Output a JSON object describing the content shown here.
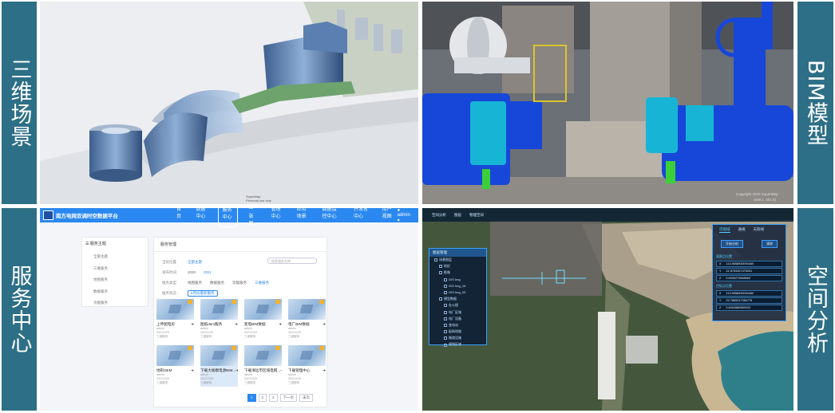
{
  "labels": {
    "q1": "三维场景",
    "q2": "BIM模型",
    "q3": "服务中心",
    "q4": "空间分析"
  },
  "scene3d": {
    "watermark_line1": "SuperMap",
    "watermark_line2": "Personal use only"
  },
  "bim": {
    "watermark": "Copyright 2020 SuperMap",
    "coords": "(509,1, 301.5)"
  },
  "service": {
    "header": {
      "title": "南方电网双调时空数据平台",
      "nav": [
        "首页",
        "数据中心",
        "服务中心",
        "一张图",
        "管理中心",
        "应用场景",
        "数据监控中心",
        "开发者中心",
        "用户视图"
      ],
      "active_index": 2,
      "user": "admin"
    },
    "left_panel": {
      "title": "服务主题",
      "items": [
        "全部主题",
        "三维服务",
        "地图服务",
        "数据服务",
        "功能服务"
      ]
    },
    "main_panel": {
      "title": "服务管理",
      "search_placeholder": "搜索服务名称",
      "filters": [
        {
          "label": "当前位置",
          "values": [
            "全部主题"
          ]
        },
        {
          "label": "发布时间",
          "values": [
            "2020",
            "2021"
          ]
        },
        {
          "label": "服务类型",
          "values": [
            "地图服务",
            "数据服务",
            "功能服务",
            "三维服务"
          ]
        },
        {
          "label": "服务状态",
          "values": [
            "5月份最新服务"
          ]
        }
      ]
    },
    "cards": [
      {
        "name": "上传配电房",
        "user": "admin",
        "date": "2021/1/29",
        "views": "三维服务"
      },
      {
        "name": "图纸dem服务",
        "user": "admin",
        "date": "2021/1/29",
        "views": "三维服务"
      },
      {
        "name": "变电BIM数据",
        "user": "admin",
        "date": "2021/1/29",
        "views": "三维服务"
      },
      {
        "name": "电厂BIM数据",
        "user": "admin",
        "date": "2021/1/29",
        "views": "三维服务"
      },
      {
        "name": "地形DEM",
        "user": "admin",
        "date": "2021/1/29",
        "views": "三维服务"
      },
      {
        "name": "下载大规模电源BIM...",
        "user": "admin",
        "date": "2021/1/29",
        "views": "三维服务"
      },
      {
        "name": "下载清远市区域电网...",
        "user": "admin",
        "date": "2021/1/29",
        "views": "三维服务"
      },
      {
        "name": "下载管理中心",
        "user": "admin",
        "date": "2021/1/29",
        "views": "三维服务"
      }
    ],
    "pager": [
      "1",
      "2",
      "3",
      "下一页",
      "末页"
    ]
  },
  "spatial": {
    "topbar": [
      "空间分析",
      "图层",
      "物理空间"
    ],
    "tree_title": "图层管理",
    "tree_items": [
      "场景图层",
      "地形",
      "影像",
      "GIS Img",
      "GIS Img_16",
      "GIS Img_09",
      "模型数据",
      "办公楼",
      "电厂区域",
      "电厂设备",
      "变电站",
      "配网线路",
      "隧道设施",
      "规划区域"
    ],
    "right_tabs": [
      "可视域",
      "通视",
      "天际线"
    ],
    "right_buttons": [
      "开始分析",
      "清除"
    ],
    "section_start": "观察点位置",
    "section_end": "目标点位置",
    "start_coords": [
      "113.9658930094460",
      "22.5753327475291",
      "0.6930274668563"
    ],
    "end_coords": [
      "113.9658930094460",
      "22.7860017384776",
      "0.6054580989303"
    ]
  }
}
